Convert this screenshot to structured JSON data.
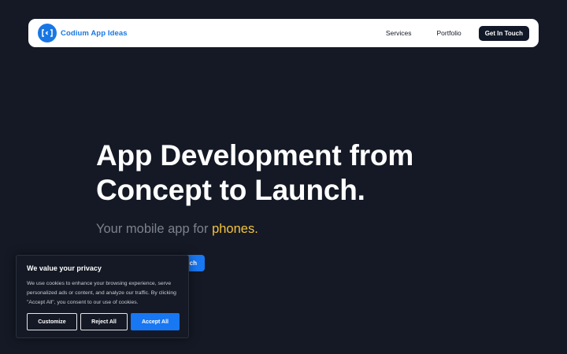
{
  "colors": {
    "background": "#141925",
    "brand_blue": "#1877e5",
    "highlight_yellow": "#f5c33b",
    "nav_cta_bg": "#111827",
    "accept_blue": "#1877f2"
  },
  "navbar": {
    "brand_logo_icon": "code-brackets-icon",
    "brand_name": "Codium App Ideas",
    "links": [
      "Services",
      "Portfolio"
    ],
    "cta_label": "Get In Touch"
  },
  "hero": {
    "title_line1": "App Development from",
    "title_line2": "Concept to Launch.",
    "subtitle_prefix": "Your mobile app for ",
    "subtitle_highlight": "phones.",
    "secondary_button_label": "ch"
  },
  "cookie_banner": {
    "title": "We value your privacy",
    "text": "We use cookies to enhance your browsing experience, serve personalized ads or content, and analyze our traffic. By clicking \"Accept All\", you consent to our use of cookies.",
    "customize_label": "Customize",
    "reject_label": "Reject All",
    "accept_label": "Accept All"
  }
}
